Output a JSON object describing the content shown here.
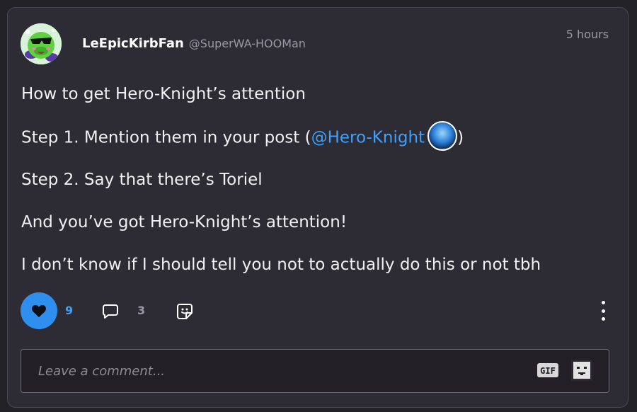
{
  "post": {
    "author": {
      "display_name": "LeEpicKirbFan",
      "handle": "@SuperWA-HOOMan"
    },
    "timestamp": "5 hours",
    "lines": [
      "How to get Hero-Knight’s attention",
      "Step 1. Mention them in your post (",
      "Step 2. Say that there’s Toriel",
      "And you’ve got Hero-Knight’s attention!",
      "I don’t know if I should tell you not to actually do this or not tbh"
    ],
    "mention": {
      "text": "@Hero-Knight",
      "suffix": ")"
    },
    "actions": {
      "like_count": "9",
      "comment_count": "3",
      "like_icon": "heart-icon",
      "comment_icon": "speech-bubble-icon",
      "sticker_icon": "sticker-icon",
      "more_icon": "vertical-ellipsis-icon"
    },
    "comment_box": {
      "placeholder": "Leave a comment...",
      "gif_label": "GIF",
      "emoji_icon": "pixel-face-icon"
    }
  },
  "colors": {
    "background": "#232228",
    "card": "#2d2b33",
    "accent": "#2f8fee",
    "mention": "#3ea0ff",
    "muted_text": "#9a98a2"
  }
}
